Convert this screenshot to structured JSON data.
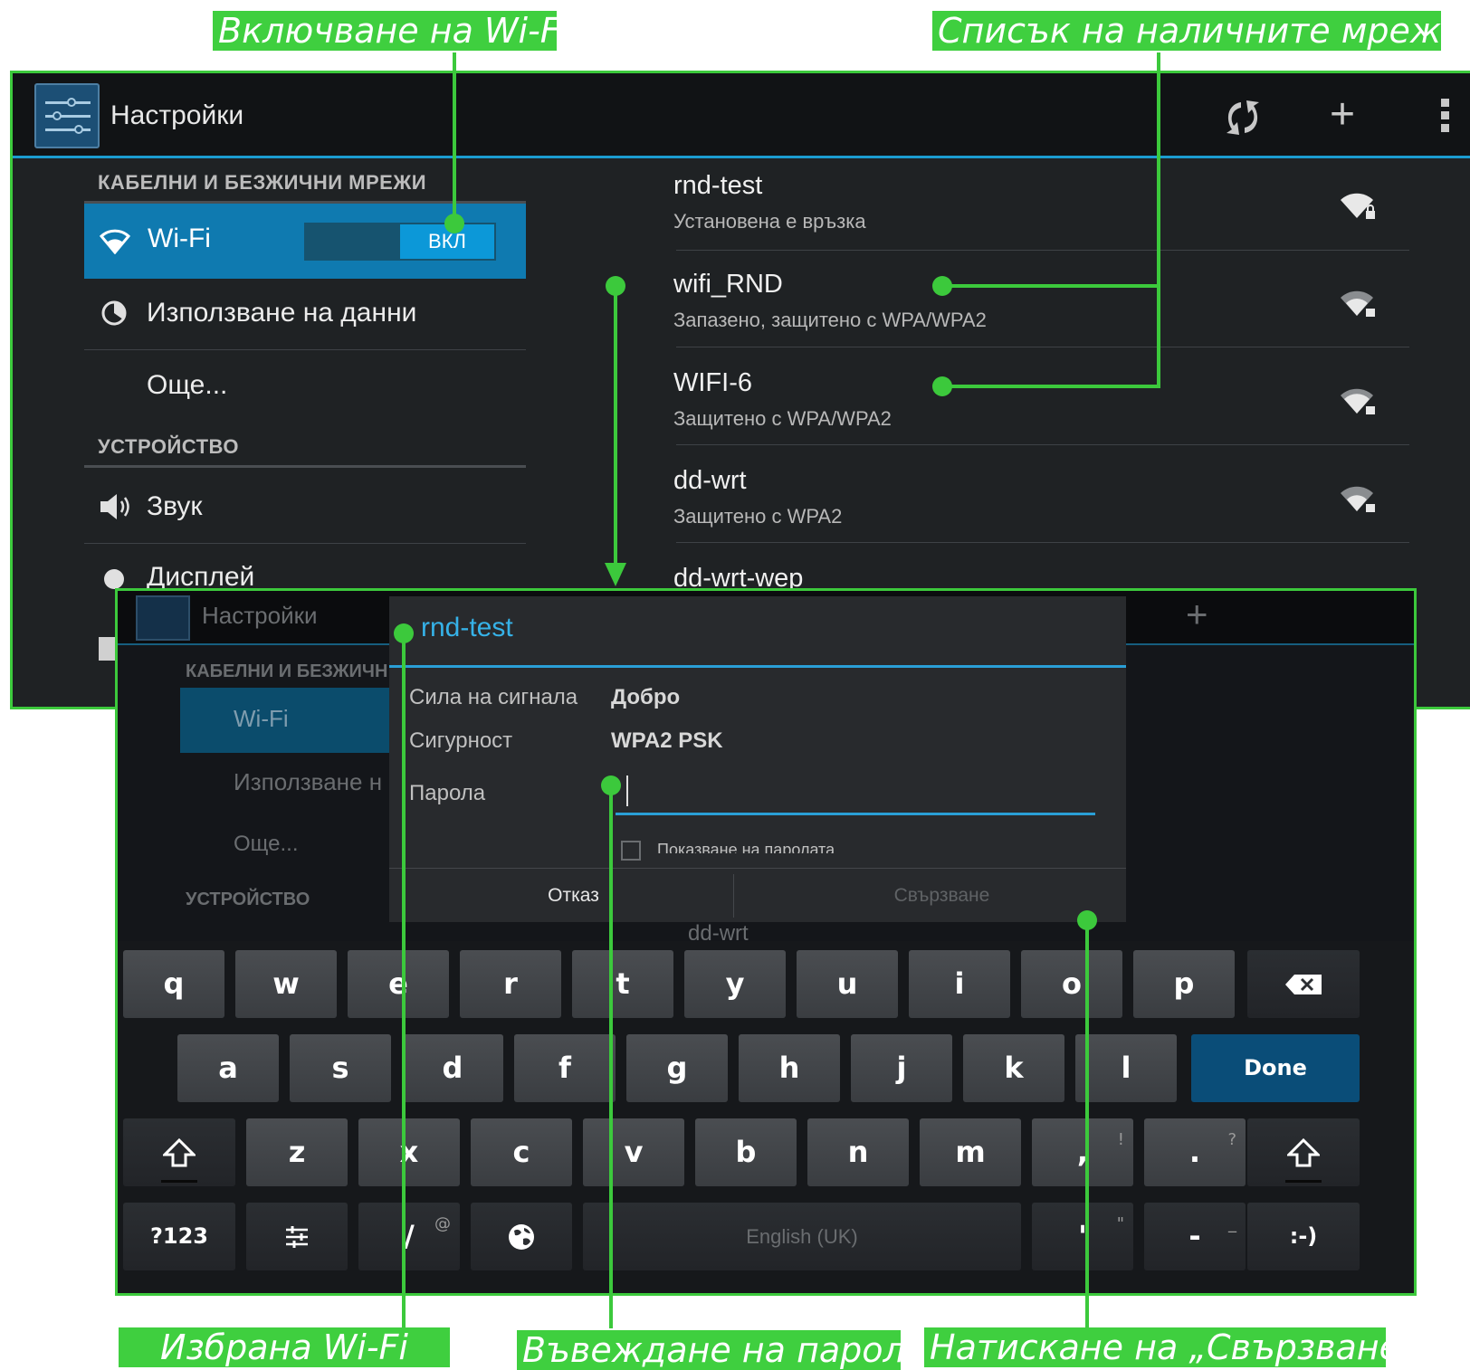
{
  "annotations": {
    "enable_wifi": "Включване на Wi-Fi",
    "networks_list": "Списък на наличните мрежи",
    "selected_wifi": "Избрана Wi-Fi",
    "enter_password": "Въвеждане на парола",
    "press_connect": "Натискане на „Свързване”"
  },
  "screen1": {
    "title": "Настройки",
    "actions": [
      "refresh-wps-icon",
      "add-network-icon",
      "overflow-menu-icon"
    ],
    "section_wireless": "КАБЕЛНИ И БЕЗЖИЧНИ МРЕЖИ",
    "wifi_label": "Wi-Fi",
    "wifi_toggle": "ВКЛ",
    "data_usage": "Използване на данни",
    "more": "Още...",
    "section_device": "УСТРОЙСТВО",
    "sound": "Звук",
    "display_partial": "Дисплей",
    "networks": [
      {
        "name": "rnd-test",
        "status": "Установена е връзка"
      },
      {
        "name": "wifi_RND",
        "status": "Запазено, защитено с WPA/WPA2"
      },
      {
        "name": "WIFI-6",
        "status": "Защитено с WPA/WPA2"
      },
      {
        "name": "dd-wrt",
        "status": "Защитено с WPA2"
      },
      {
        "name": "dd-wrt-wep",
        "status": ""
      }
    ]
  },
  "screen2": {
    "title": "Настройки",
    "section_wireless": "КАБЕЛНИ И БЕЗЖИЧН",
    "wifi_label": "Wi-Fi",
    "data_usage": "Използване н",
    "more": "Още...",
    "section_device": "УСТРОЙСТВО",
    "bg_network": "dd-wrt",
    "dialog": {
      "title": "rnd-test",
      "signal_label": "Сила на сигнала",
      "signal_value": "Добро",
      "security_label": "Сигурност",
      "security_value": "WPA2 PSK",
      "password_label": "Парола",
      "password_value": "",
      "show_password": "Показване на паролата",
      "cancel": "Отказ",
      "connect": "Свързване"
    },
    "keyboard": {
      "row1": [
        "q",
        "w",
        "e",
        "r",
        "t",
        "y",
        "u",
        "i",
        "o",
        "p"
      ],
      "row2": [
        "a",
        "s",
        "d",
        "f",
        "g",
        "h",
        "j",
        "k",
        "l"
      ],
      "done": "Done",
      "row3": [
        "z",
        "x",
        "c",
        "v",
        "b",
        "n",
        "m",
        ",",
        "."
      ],
      "row3_alt": {
        "comma": "!",
        "period": "?"
      },
      "numbers": "?123",
      "slash": "/",
      "slash_alt": "@",
      "space": "English (UK)",
      "apostrophe": "'",
      "apostrophe_alt": "\"",
      "dash": "-",
      "dash_alt": "_",
      "smiley": ":-)"
    }
  },
  "colors": {
    "annotation_green": "#3fcf3f",
    "accent_blue": "#1b9cd0",
    "selected_row": "#0f7ab0",
    "done_key": "#0a4d78"
  }
}
